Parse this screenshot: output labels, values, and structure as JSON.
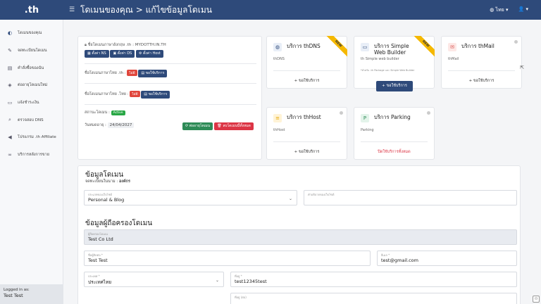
{
  "header": {
    "brand": ".th",
    "menu_icon": "hamburger-icon",
    "title": "โดเมนของคุณ > แก้ไขข้อมูลโดเมน",
    "language": "ไทย",
    "user_icon": "user-icon"
  },
  "sidebar": {
    "items": [
      {
        "label": "โดเมนของคุณ",
        "icon": "globe-icon"
      },
      {
        "label": "จดทะเบียนโดเมน",
        "icon": "pencil-icon"
      },
      {
        "label": "คำสั่งซื้อของฉัน",
        "icon": "clipboard-icon"
      },
      {
        "label": "ต่ออายุโดเมนใหม่",
        "icon": "tag-icon"
      },
      {
        "label": "แจ้งชำระเงิน",
        "icon": "card-icon"
      },
      {
        "label": "ตรวจสอบ DNS",
        "icon": "search-icon"
      },
      {
        "label": "โปรแกรม .th Affiliate",
        "icon": "megaphone-icon"
      },
      {
        "label": "บริการหลังการขาย",
        "icon": "link-icon"
      }
    ],
    "logged_label": "Logged in as:",
    "logged_user": "Test Test"
  },
  "domain": {
    "name_line": "ชื่อโดเมนภาษาอังกฤษ .th : MYDOTTH.IN.TH",
    "btn_ns": "ตั้งค่า NS",
    "btn_ds": "ตั้งค่า DS",
    "btn_host": "ตั้งค่า Host",
    "thai_line": "ชื่อโดเมนภาษาไทย .th :",
    "thai_dot_line": "ชื่อโดเมนภาษาไทย .ไทย :",
    "badge_none": "ไม่มี",
    "btn_use": "ขอใช้บริการ",
    "status_label": "สถานะโดเมน :",
    "status_value": "Active",
    "expiry_label": "วันหมดอายุ :",
    "expiry_value": "24/04/2027",
    "btn_renew": "ต่ออายุโดเมน",
    "btn_delete": "ลบโดเมนนี้ทั้งหมด"
  },
  "services": [
    {
      "name": "บริการ thDNS",
      "desc": "thDNS",
      "action": "+ ขอใช้บริการ",
      "ribbon": "NEW",
      "icon": "globe-icon",
      "color": "#e8eef7"
    },
    {
      "name": "บริการ Simple Web Builder",
      "desc": "th Simple web builder",
      "note": "*สำหรับ .th Package และ Simple Web Builder",
      "action": "+ ขอใช้บริการ",
      "ribbon": "NEW",
      "icon": "browser-icon",
      "color": "#e8eef7"
    },
    {
      "name": "บริการ thMail",
      "desc": "thMail",
      "action": "+ ขอใช้บริการ",
      "icon": "mail-icon",
      "color": "#fde8e6"
    },
    {
      "name": "บริการ thHost",
      "desc": "thHost",
      "action": "+ ขอใช้บริการ",
      "icon": "server-icon",
      "color": "#fff3d6"
    },
    {
      "name": "บริการ Parking",
      "desc": "Parking",
      "action": "ปิดใช้บริการทั้งหมด",
      "icon": "parking-icon",
      "color": "#e3f4ea"
    }
  ],
  "info": {
    "title": "ข้อมูลโดเมน",
    "subtitle_prefix": "จดทะเบียนในนาม :",
    "subtitle_value": "องค์กร",
    "category_label": "ประเภทของเว็บไซต์",
    "category_value": "Personal & Blog",
    "desc_label": "คำอธิบายของเว็บไซต์",
    "holder_title": "ข้อมูลผู้ถือครองโดเมน",
    "org_label": "ผู้ถือครองโดเมน",
    "org_value": "Test Co Ltd",
    "name_label": "ชื่อผู้ติดต่อ *",
    "name_value": "Test Test",
    "email_label": "อีเมล *",
    "email_value": "test@gmail.com",
    "country_label": "ประเทศ *",
    "country_value": "ประเทศไทย",
    "addr_label": "ที่อยู่ *",
    "addr_value": "test12345test",
    "addr2_label": "ที่อยู่ (ต่อ)"
  }
}
